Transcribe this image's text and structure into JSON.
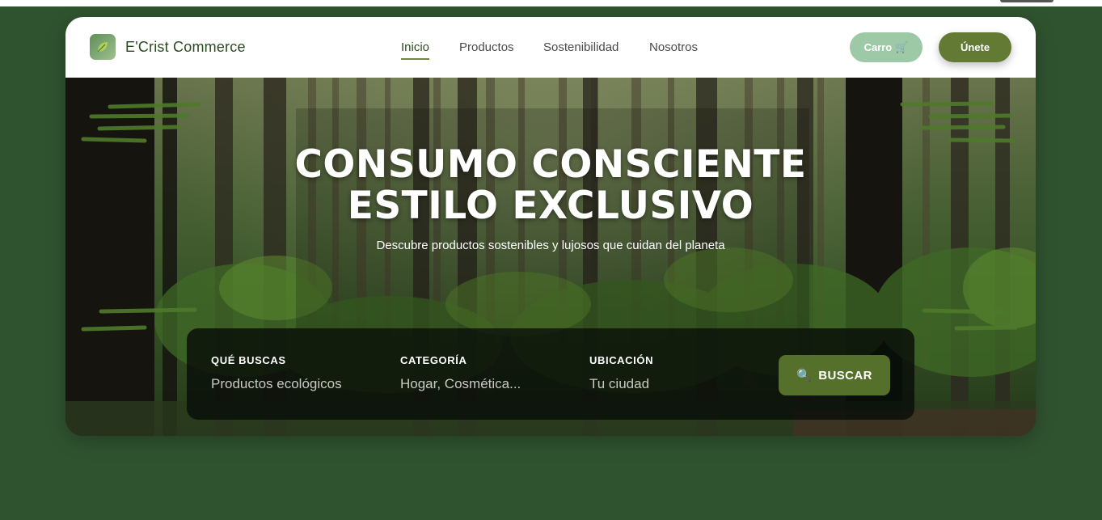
{
  "header": {
    "brand": "E'Crist Commerce",
    "logo_icon": "leaf-icon",
    "nav": [
      {
        "label": "Inicio",
        "active": true
      },
      {
        "label": "Productos",
        "active": false
      },
      {
        "label": "Sostenibilidad",
        "active": false
      },
      {
        "label": "Nosotros",
        "active": false
      }
    ],
    "cart_label": "Carro",
    "cart_icon": "🛒",
    "join_label": "Únete"
  },
  "hero": {
    "title_line1": "CONSUMO CONSCIENTE",
    "title_line2": "ESTILO EXCLUSIVO",
    "subtitle": "Descubre productos sostenibles y lujosos que cuidan del planeta"
  },
  "search": {
    "fields": [
      {
        "label": "QUÉ BUSCAS",
        "value": "Productos ecológicos"
      },
      {
        "label": "CATEGORÍA",
        "value": "Hogar, Cosmética..."
      },
      {
        "label": "UBICACIÓN",
        "value": "Tu ciudad"
      }
    ],
    "button_label": "BUSCAR",
    "button_icon": "🔍"
  },
  "colors": {
    "page_background": "#30532f",
    "primary_green": "#627a34",
    "cart_button": "#9ec9a7",
    "search_button": "#55702a",
    "brand_text": "#2c4a22"
  }
}
